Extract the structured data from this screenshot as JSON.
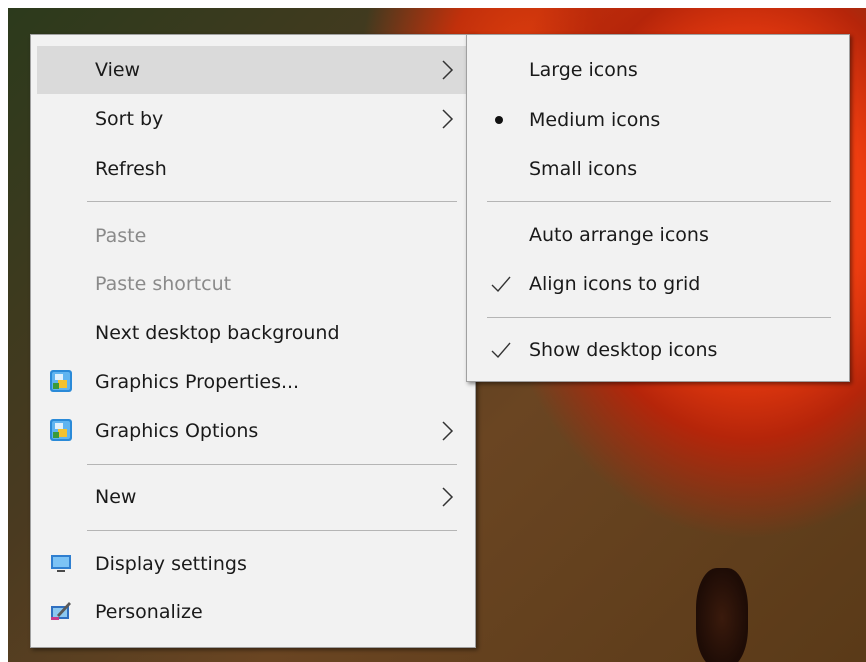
{
  "main_menu": {
    "view": "View",
    "sort_by": "Sort by",
    "refresh": "Refresh",
    "paste": "Paste",
    "paste_shortcut": "Paste shortcut",
    "next_background": "Next desktop background",
    "graphics_properties": "Graphics Properties...",
    "graphics_options": "Graphics Options",
    "new": "New",
    "display_settings": "Display settings",
    "personalize": "Personalize"
  },
  "view_submenu": {
    "large_icons": "Large icons",
    "medium_icons": "Medium icons",
    "small_icons": "Small icons",
    "auto_arrange": "Auto arrange icons",
    "align_to_grid": "Align icons to grid",
    "show_desktop_icons": "Show desktop icons",
    "selected_size": "Medium icons",
    "checked": [
      "Align icons to grid",
      "Show desktop icons"
    ]
  },
  "colors": {
    "menu_bg": "#f2f2f2",
    "highlight": "#dadada",
    "disabled_text": "#8a8a8a"
  }
}
